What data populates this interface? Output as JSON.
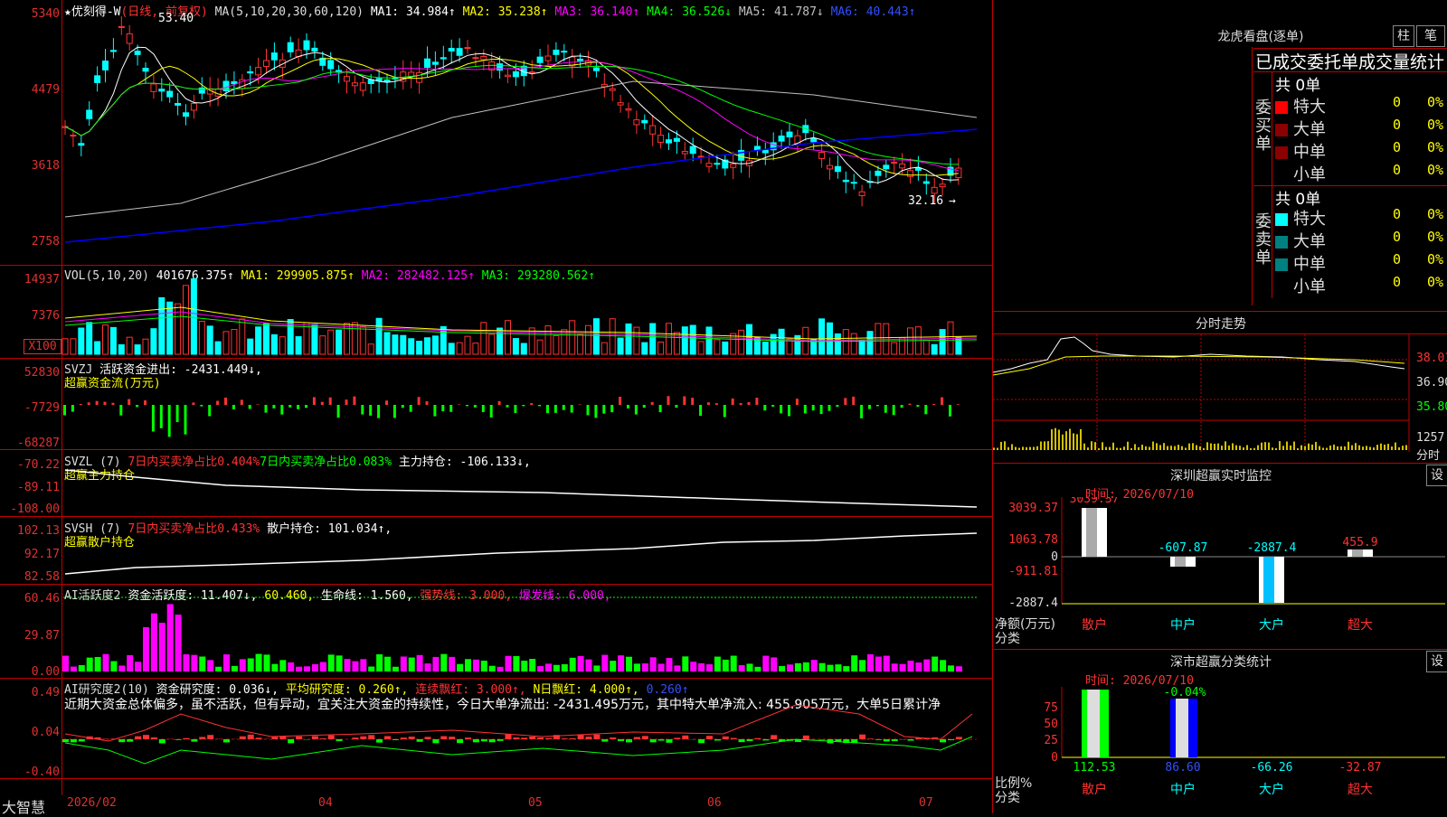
{
  "colors": {
    "up": "#ff3232",
    "down": "#00ffff",
    "grid": "#c00000",
    "bg": "#000000",
    "ma1": "#ffffff",
    "ma2": "#ffff00",
    "ma3": "#ff00ff",
    "ma4": "#00ff00",
    "ma5": "#c0c0c0",
    "ma6": "#0000ff",
    "green_bar": "#00ff00",
    "magenta_bar": "#ff00ff"
  },
  "price_panel": {
    "title": "优刻得-W",
    "period": "(日线, 前复权)",
    "ma_text": "MA(5,10,20,30,60,120)",
    "ma1": "MA1: 34.984↑",
    "ma2": "MA2: 35.238↑",
    "ma3": "MA3: 36.140↑",
    "ma4": "MA4: 36.526↓",
    "ma5": "MA5: 41.787↓",
    "ma6": "MA6: 40.443↑",
    "y_labels": [
      "5340",
      "4479",
      "3618",
      "2758"
    ],
    "high_label": "53.40",
    "low_label": "32.16"
  },
  "vol_panel": {
    "header": "VOL(5,10,20)",
    "val": "401676.375↑",
    "ma1": "MA1: 299905.875↑",
    "ma2": "MA2: 282482.125↑",
    "ma3": "MA3: 293280.562↑",
    "y_labels": [
      "14937",
      "7376"
    ],
    "unit": "X100"
  },
  "svzj_panel": {
    "header": "SVZJ",
    "title": "活跃资金进出: -2431.449↓,",
    "sub": "超赢资金流(万元)",
    "y_labels": [
      "52830",
      "-7729",
      "-68287"
    ]
  },
  "svzl_panel": {
    "header": "SVZL (7)",
    "t1": "7日内买卖净占比0.404%",
    "t2": "7日内买卖净占比0.083%",
    "t3": "主力持仓: -106.133↓,",
    "sub": "超赢主力持仓",
    "y_labels": [
      "-70.22",
      "-89.11",
      "-108.00"
    ]
  },
  "svsh_panel": {
    "header": "SVSH (7)",
    "t1": "7日内买卖净占比0.433%",
    "t2": "散户持仓: 101.034↑,",
    "sub": "超赢散户持仓",
    "y_labels": [
      "102.13",
      "92.17",
      "82.58"
    ]
  },
  "ai_panel": {
    "header": "AI活跃度2",
    "t1": "资金活跃度: 11.407↓,",
    "t2": "60.460,",
    "t3": "生命线: 1.560,",
    "t4": "强势线: 3.000,",
    "t5": "爆发线: 6.000,",
    "y_labels": [
      "60.46",
      "29.87",
      "0.00"
    ]
  },
  "research_panel": {
    "header": "AI研究度2(10)",
    "t1": "资金研究度: 0.036↓,",
    "t2": "平均研究度: 0.260↑,",
    "t3": "连续飘红: 3.000↑,",
    "t4": "N日飘红: 4.000↑,",
    "t5": "0.260↑",
    "comment": "近期大资金总体偏多，虽不活跃，但有异动，宜关注大资金的持续性，今日大单净流出: -2431.495万元，其中特大单净流入: 455.905万元，大单5日累计净",
    "y_labels": [
      "0.49",
      "0.04",
      "-0.40"
    ]
  },
  "x_axis": {
    "brand": "大智慧",
    "labels": [
      "2026/02",
      "04",
      "05",
      "06",
      "07"
    ]
  },
  "right": {
    "lhb_title": "龙虎看盘(逐单)",
    "btn_zhu": "柱",
    "btn_bi": "笔",
    "stats_title": "已成交委托单成交量统计",
    "buy_label": "委买单",
    "sell_label": "委卖单",
    "buy_total": "共 0单",
    "sell_total": "共 0单",
    "rows": [
      {
        "name": "特大",
        "n": "0",
        "p": "0%"
      },
      {
        "name": "大单",
        "n": "0",
        "p": "0%"
      },
      {
        "name": "中单",
        "n": "0",
        "p": "0%"
      },
      {
        "name": "小单",
        "n": "0",
        "p": "0%"
      }
    ],
    "fs_title": "分时走势",
    "fs_y": [
      "38.01",
      "36.90",
      "35.80"
    ],
    "fs_vol": "1257",
    "fs_unit": "分时",
    "sz_title": "深圳超赢实时监控",
    "sz_btn": "设",
    "sz_time": "时间: 2026/07/10",
    "sz_y": [
      "3039.37",
      "1063.78",
      "0",
      "-911.81",
      "-2887.4"
    ],
    "sz_vals": [
      "3039.37",
      "-607.87",
      "-2887.4",
      "455.9"
    ],
    "sz_axis1": "净额(万元)",
    "sz_axis2": "分类",
    "cats": [
      "散户",
      "中户",
      "大户",
      "超大"
    ],
    "cls_title": "深市超赢分类统计",
    "cls_btn": "设",
    "cls_time": "时间: 2026/07/10",
    "cls_y": [
      "75",
      "50",
      "25",
      "0"
    ],
    "cls_top": "-0.04%",
    "cls_vals": [
      "112.53",
      "86.60",
      "-66.26",
      "-32.87"
    ],
    "cls_axis1": "比例%",
    "cls_axis2": "分类"
  }
}
